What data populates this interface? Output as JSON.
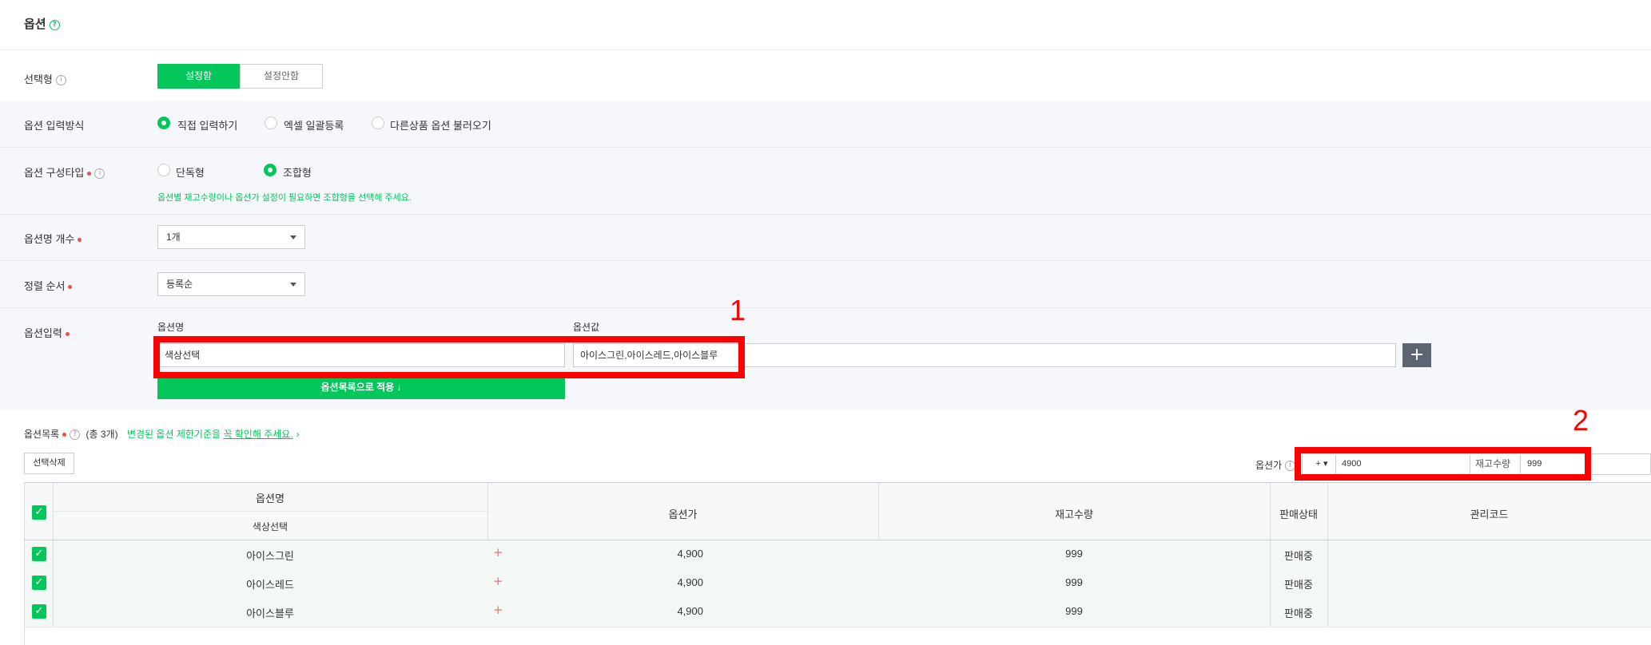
{
  "section": {
    "title": "옵션"
  },
  "select_type": {
    "label": "선택형",
    "on": "설정함",
    "off": "설정안함"
  },
  "input_method": {
    "label": "옵션 입력방식",
    "options": [
      "직접 입력하기",
      "엑셀 일괄등록",
      "다른상품 옵션 불러오기"
    ],
    "selected": 0
  },
  "config_type": {
    "label": "옵션 구성타입",
    "options": [
      "단독형",
      "조합형"
    ],
    "selected": 1,
    "hint": "옵션별 재고수량이나 옵션가 설정이 필요하면 조합형을 선택해 주세요."
  },
  "name_count": {
    "label": "옵션명 개수",
    "value": "1개"
  },
  "sort_order": {
    "label": "정렬 순서",
    "value": "등록순"
  },
  "option_input": {
    "label": "옵션입력",
    "name_header": "옵션명",
    "value_header": "옵션값",
    "name_value": "색상선택",
    "value_value": "아이스그린,아이스레드,아이스블루",
    "apply_button": "옵션목록으로 적용 ↓",
    "add_icon": "plus-icon"
  },
  "annotations": {
    "one": "1",
    "two": "2"
  },
  "option_list": {
    "label": "옵션목록",
    "count_text": "(총 3개)",
    "notice_prefix": "변경된 옵션 제한기준을 ",
    "notice_link": "꼭 확인해 주세요.",
    "notice_arrow": "›",
    "delete_button": "선택삭제",
    "bulk": {
      "price_label": "옵션가",
      "sign": "+ ▾",
      "price": "4900",
      "stock_label": "재고수량",
      "stock": "999"
    }
  },
  "table": {
    "headers": {
      "name": "옵션명",
      "sub": "색상선택",
      "price": "옵션가",
      "stock": "재고수량",
      "status": "판매상태",
      "code": "관리코드"
    },
    "rows": [
      {
        "name": "아이스그린",
        "sign": "+",
        "price": "4,900",
        "stock": "999",
        "status": "판매중",
        "code": ""
      },
      {
        "name": "아이스레드",
        "sign": "+",
        "price": "4,900",
        "stock": "999",
        "status": "판매중",
        "code": ""
      },
      {
        "name": "아이스블루",
        "sign": "+",
        "price": "4,900",
        "stock": "999",
        "status": "판매중",
        "code": ""
      }
    ]
  },
  "colors": {
    "accent": "#03c75a",
    "annotation": "#ff0000",
    "required": "#f04e4e"
  }
}
